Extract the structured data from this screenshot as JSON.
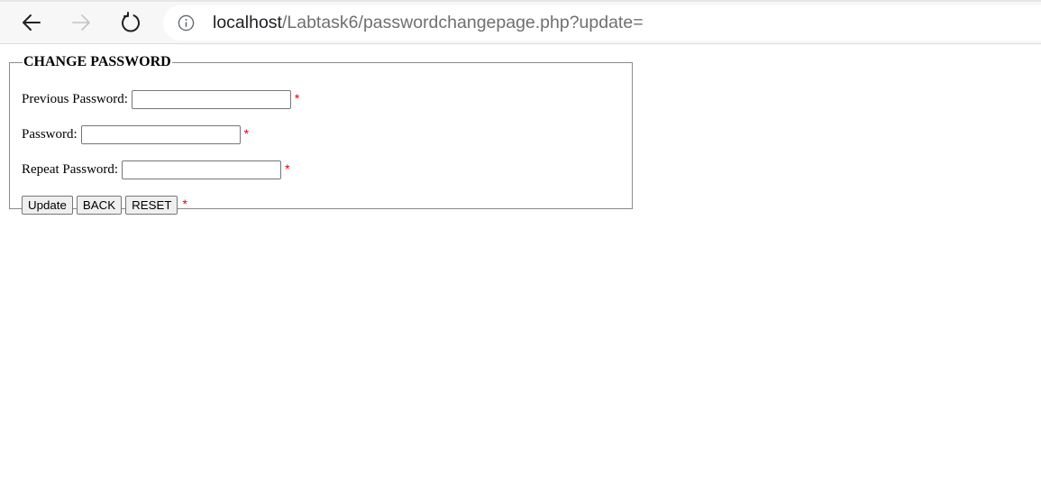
{
  "browser": {
    "url_host": "localhost",
    "url_path": "/Labtask6/passwordchangepage.php?update=",
    "icons": {
      "back": "back-arrow-icon",
      "forward": "forward-arrow-icon",
      "reload": "reload-icon",
      "info": "info-icon"
    }
  },
  "form": {
    "legend": "CHANGE PASSWORD",
    "fields": [
      {
        "label": "Previous Password:",
        "value": "",
        "required_mark": "*"
      },
      {
        "label": "Password:",
        "value": "",
        "required_mark": "*"
      },
      {
        "label": "Repeat Password:",
        "value": "",
        "required_mark": "*"
      }
    ],
    "buttons": {
      "update": "Update",
      "back": "BACK",
      "reset": "RESET"
    },
    "buttons_required_mark": "*",
    "required_color": "#e00000"
  }
}
